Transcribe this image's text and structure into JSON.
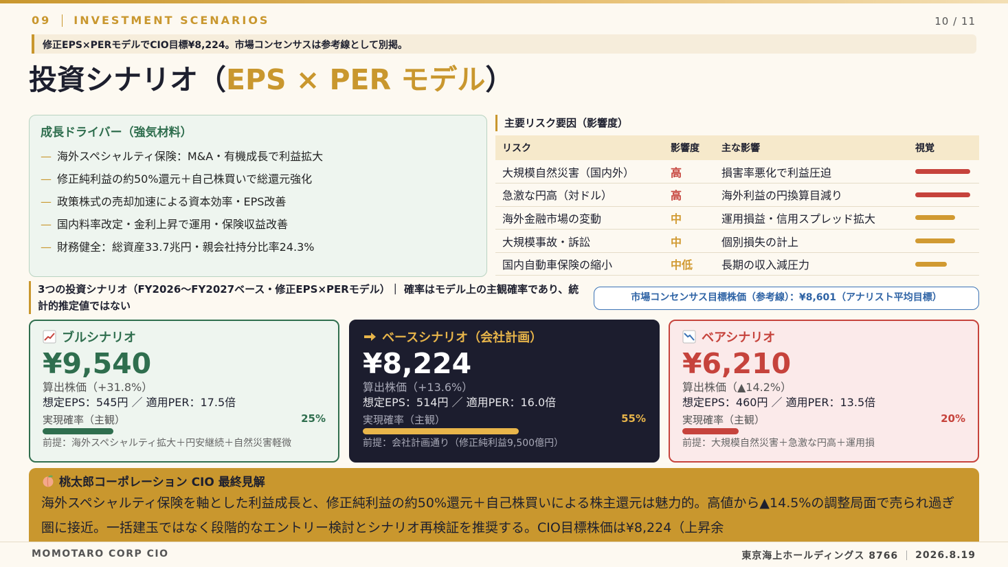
{
  "header": {
    "section": "09",
    "label": "INVESTMENT SCENARIOS",
    "page": "10 / 11"
  },
  "subtitle": "修正EPS×PERモデルでCIO目標¥8,224。市場コンセンサスは参考線として別掲。",
  "title": {
    "main": "投資シナリオ（",
    "accent": "EPS × PER モデル",
    "close": "）"
  },
  "drivers": {
    "heading": "成長ドライバー（強気材料）",
    "dash": "—",
    "items": [
      "海外スペシャルティ保険：M&A・有機成長で利益拡大",
      "修正純利益の約50%還元＋自己株買いで総還元強化",
      "政策株式の売却加速による資本効率・EPS改善",
      "国内料率改定・金利上昇で運用・保険収益改善",
      "財務健全：総資産33.7兆円・親会社持分比率24.3%"
    ]
  },
  "risks": {
    "heading": "主要リスク要因（影響度）",
    "columns": [
      "リスク",
      "影響度",
      "主な影響",
      "視覚"
    ],
    "rows": [
      {
        "risk": "大規模自然災害（国内外）",
        "level": "高",
        "impact": "損害率悪化で利益圧迫",
        "bar": 1.0,
        "color": "#c6433c"
      },
      {
        "risk": "急激な円高（対ドル）",
        "level": "高",
        "impact": "海外利益の円換算目減り",
        "bar": 1.0,
        "color": "#c6433c"
      },
      {
        "risk": "海外金融市場の変動",
        "level": "中",
        "impact": "運用損益・信用スプレッド拡大",
        "bar": 0.72,
        "color": "#d19a32"
      },
      {
        "risk": "大規模事故・訴訟",
        "level": "中",
        "impact": "個別損失の計上",
        "bar": 0.72,
        "color": "#d19a32"
      },
      {
        "risk": "国内自動車保険の縮小",
        "level": "中低",
        "impact": "長期の収入減圧力",
        "bar": 0.58,
        "color": "#d19a32"
      }
    ]
  },
  "scenarios": {
    "heading": "3つの投資シナリオ（FY2026〜FY2027ベース・修正EPS×PERモデル）｜ 確率はモデル上の主観確率であり、統計的推定値ではない",
    "consensus": "市場コンセンサス目標株価（参考線）：¥8,601（アナリスト平均目標）",
    "prob_label": "実現確率（主観）",
    "bull": {
      "name": "ブルシナリオ",
      "icon": "chart-up-icon",
      "price": "¥9,540",
      "calc": "算出株価（+31.8%）",
      "eps": "想定EPS：545円 ／ 適用PER：17.5倍",
      "prob": "25%",
      "prob_value": 0.25,
      "premise": "前提：海外スペシャルティ拡大＋円安継続＋自然災害軽微"
    },
    "base": {
      "name": "ベースシナリオ（会社計画）",
      "icon": "arrow-right-icon",
      "price": "¥8,224",
      "calc": "算出株価（+13.6%）",
      "eps": "想定EPS：514円 ／ 適用PER：16.0倍",
      "prob": "55%",
      "prob_value": 0.55,
      "premise": "前提：会社計画通り（修正純利益9,500億円）"
    },
    "bear": {
      "name": "ベアシナリオ",
      "icon": "chart-down-icon",
      "price": "¥6,210",
      "calc": "算出株価（▲14.2%）",
      "eps": "想定EPS：460円 ／ 適用PER：13.5倍",
      "prob": "20%",
      "prob_value": 0.2,
      "premise": "前提：大規模自然災害＋急激な円高＋運用損"
    }
  },
  "cio": {
    "heading": "桃太郎コーポレーション CIO 最終見解",
    "icon": "peach-icon",
    "body": "海外スペシャルティ保険を軸とした利益成長と、修正純利益の約50%還元＋自己株買いによる株主還元は魅力的。高値から▲14.5%の調整局面で売られ過ぎ圏に接近。一括建玉ではなく段階的なエントリー検討とシナリオ再検証を推奨する。CIO目標株価は¥8,224（上昇余"
  },
  "footer": {
    "left": "MOMOTARO CORP CIO",
    "company": "東京海上ホールディングス 8766",
    "date": "2026.8.19"
  }
}
